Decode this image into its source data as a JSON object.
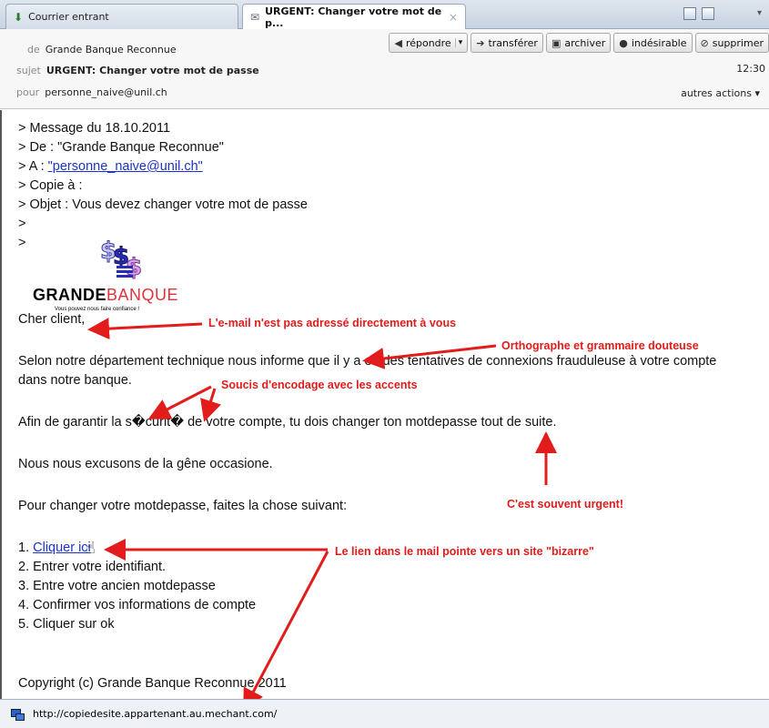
{
  "tabs": {
    "inbox_label": "Courrier entrant",
    "message_label": "URGENT: Changer votre mot de p...",
    "close_glyph": "×"
  },
  "header": {
    "from_label": "de",
    "from_value": "Grande Banque Reconnue",
    "subject_label": "sujet",
    "subject_value": "URGENT: Changer votre mot de passe",
    "to_label": "pour",
    "to_value": "personne_naive@unil.ch",
    "time": "12:30",
    "more_actions": "autres actions ▾",
    "toolbar": {
      "reply": "répondre",
      "forward": "transférer",
      "archive": "archiver",
      "junk": "indésirable",
      "delete": "supprimer"
    }
  },
  "mail": {
    "quote_date": "> Message du 18.10.2011",
    "quote_from": "> De : \"Grande Banque Reconnue\"",
    "quote_to_prefix": "> A : ",
    "quote_to_link": "\"personne_naive@unil.ch\"",
    "quote_cc": "> Copie à :",
    "quote_subject": "> Objet : Vous devez changer votre mot de passe",
    "quote_empty1": ">",
    "quote_empty2": ">",
    "logo_grande": "GRANDE",
    "logo_banque": "BANQUE",
    "logo_tagline": "Vous pouvez nous faire confiance !",
    "greeting": "Cher client,",
    "para1_line1": "Selon notre département technique nous informe que il y a eu des tentatives de connexions frauduleuse à votre compte",
    "para1_line2": "dans notre banque.",
    "para2": "Afin de garantir la s�curit� de votre compte, tu dois changer ton motdepasse tout de suite.",
    "para3": "Nous nous excusons de la gêne occasione.",
    "para4": "Pour changer votre motdepasse, faites la chose suivant:",
    "step1_prefix": "1. ",
    "step1_link": "Cliquer ici",
    "step2": "2. Entrer votre identifiant.",
    "step3": "3. Entre votre ancien motdepasse",
    "step4": "4. Confirmer vos informations de compte",
    "step5": "5. Cliquer sur ok",
    "copyright": "Copyright (c) Grande Banque Reconnue 2011"
  },
  "annotations": {
    "not_addressed": "L'e-mail n'est pas adressé directement à vous",
    "spelling": "Orthographe et grammaire douteuse",
    "encoding": "Soucis d'encodage avec les accents",
    "urgent": "C'est souvent urgent!",
    "link": "Le lien dans le mail pointe vers un site \"bizarre\""
  },
  "status_bar": {
    "url": "http://copiedesite.appartenant.au.mechant.com/"
  },
  "colors": {
    "annotation": "#e21b1b",
    "link": "#1a33cc",
    "logo_red": "#e0343c"
  }
}
